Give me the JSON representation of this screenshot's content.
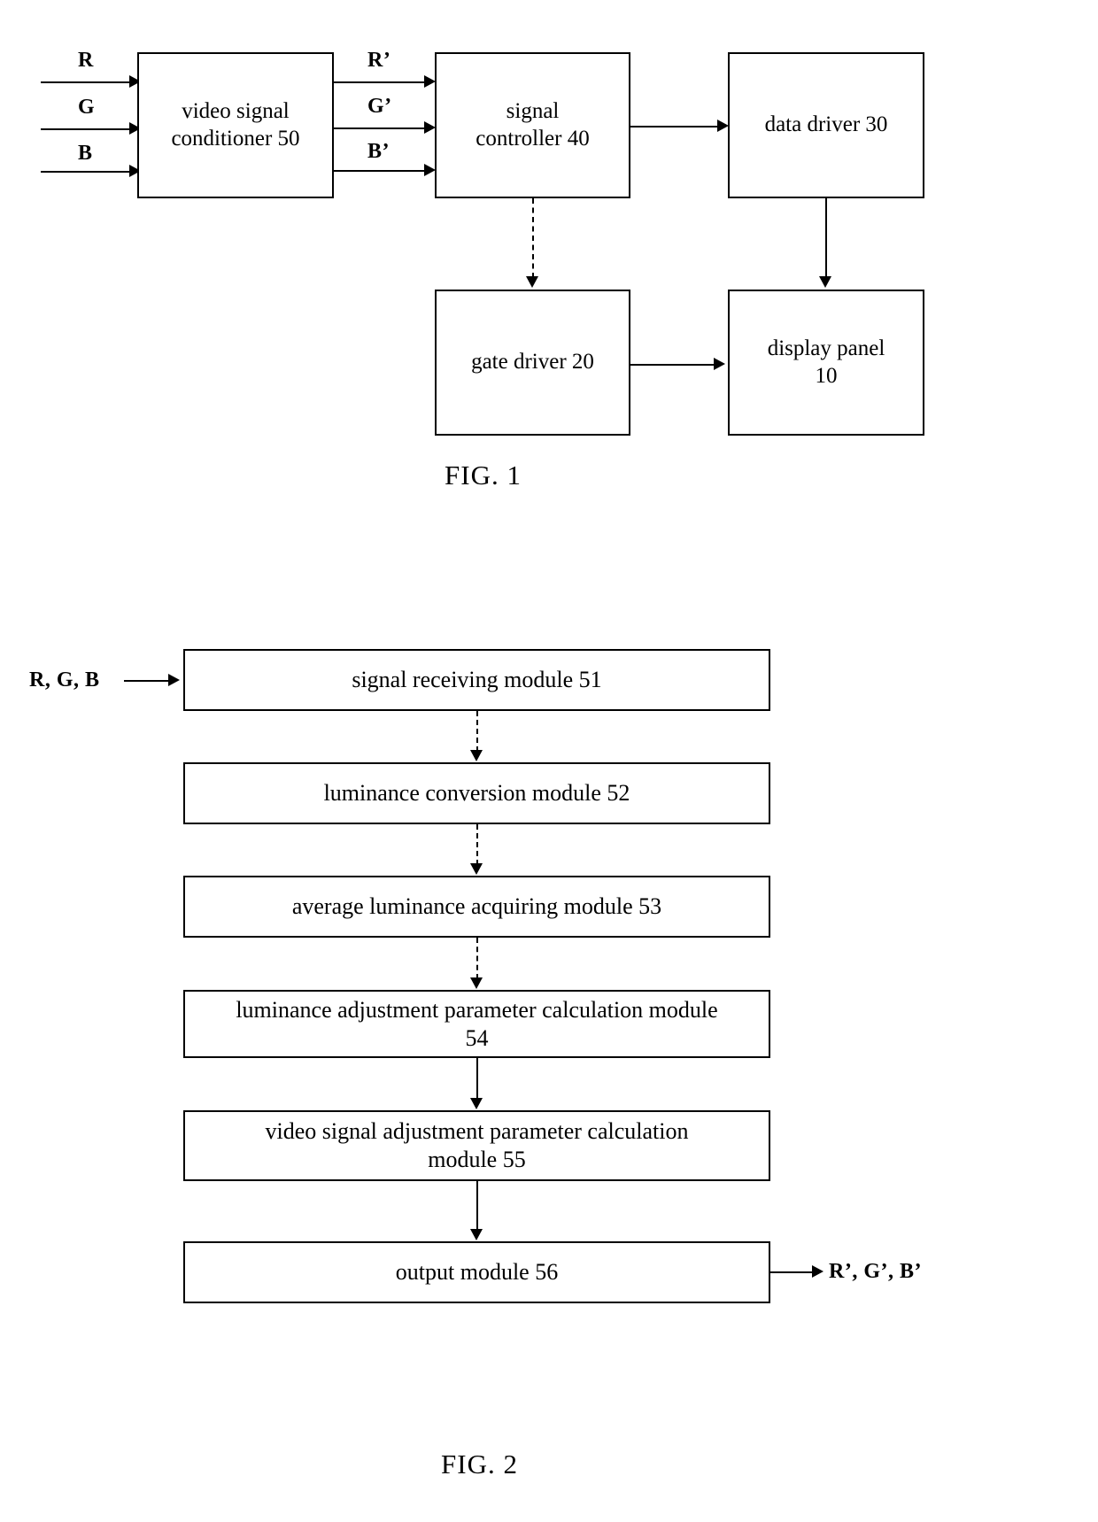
{
  "document": {
    "type": "patent-drawing-sheet",
    "figures": [
      {
        "id": "fig1",
        "caption": "FIG. 1",
        "inputs": [
          {
            "label": "R"
          },
          {
            "label": "G"
          },
          {
            "label": "B"
          }
        ],
        "intermediate_labels": [
          {
            "label": "R’"
          },
          {
            "label": "G’"
          },
          {
            "label": "B’"
          }
        ],
        "nodes": [
          {
            "id": "video_signal_conditioner",
            "label": "video signal\nconditioner 50"
          },
          {
            "id": "signal_controller",
            "label": "signal\ncontroller 40"
          },
          {
            "id": "data_driver",
            "label": "data driver 30"
          },
          {
            "id": "gate_driver",
            "label": "gate driver 20"
          },
          {
            "id": "display_panel",
            "label": "display panel\n10"
          }
        ],
        "edges": [
          {
            "from": "R",
            "to": "video_signal_conditioner",
            "style": "solid"
          },
          {
            "from": "G",
            "to": "video_signal_conditioner",
            "style": "solid"
          },
          {
            "from": "B",
            "to": "video_signal_conditioner",
            "style": "solid"
          },
          {
            "from": "video_signal_conditioner",
            "to": "signal_controller",
            "style": "solid",
            "label": "R’"
          },
          {
            "from": "video_signal_conditioner",
            "to": "signal_controller",
            "style": "solid",
            "label": "G’"
          },
          {
            "from": "video_signal_conditioner",
            "to": "signal_controller",
            "style": "solid",
            "label": "B’"
          },
          {
            "from": "signal_controller",
            "to": "data_driver",
            "style": "solid"
          },
          {
            "from": "signal_controller",
            "to": "gate_driver",
            "style": "dashed"
          },
          {
            "from": "data_driver",
            "to": "display_panel",
            "style": "solid"
          },
          {
            "from": "gate_driver",
            "to": "display_panel",
            "style": "solid"
          }
        ]
      },
      {
        "id": "fig2",
        "caption": "FIG. 2",
        "input_label": "R, G, B",
        "output_label": "R’, G’, B’",
        "nodes": [
          {
            "id": "m51",
            "label": "signal receiving module 51"
          },
          {
            "id": "m52",
            "label": "luminance conversion module 52"
          },
          {
            "id": "m53",
            "label": "average luminance acquiring module 53"
          },
          {
            "id": "m54",
            "label": "luminance adjustment parameter calculation module\n54"
          },
          {
            "id": "m55",
            "label": "video signal adjustment parameter calculation\nmodule 55"
          },
          {
            "id": "m56",
            "label": "output module 56"
          }
        ],
        "edges": [
          {
            "from": "input",
            "to": "m51",
            "style": "solid"
          },
          {
            "from": "m51",
            "to": "m52",
            "style": "dashed"
          },
          {
            "from": "m52",
            "to": "m53",
            "style": "dashed"
          },
          {
            "from": "m53",
            "to": "m54",
            "style": "dashed"
          },
          {
            "from": "m54",
            "to": "m55",
            "style": "solid"
          },
          {
            "from": "m55",
            "to": "m56",
            "style": "solid"
          },
          {
            "from": "m56",
            "to": "output",
            "style": "solid"
          }
        ]
      }
    ]
  },
  "colors": {
    "ink": "#000000",
    "paper": "#ffffff"
  }
}
